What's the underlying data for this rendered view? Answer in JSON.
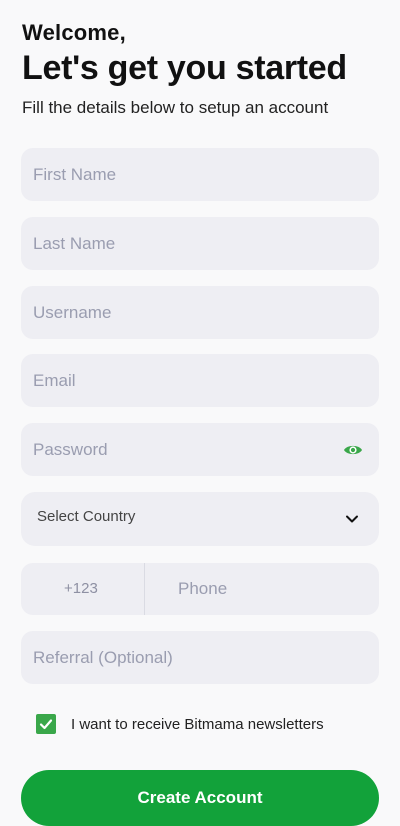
{
  "header": {
    "welcome": "Welcome,",
    "headline": "Let's get you started",
    "subline": "Fill the details below to setup an account"
  },
  "form": {
    "first_name": {
      "placeholder": "First Name",
      "value": ""
    },
    "last_name": {
      "placeholder": "Last Name",
      "value": ""
    },
    "username": {
      "placeholder": "Username",
      "value": ""
    },
    "email": {
      "placeholder": "Email",
      "value": ""
    },
    "password": {
      "placeholder": "Password",
      "value": "",
      "toggle_icon": "eye-icon"
    },
    "country": {
      "label": "Select Country",
      "icon": "chevron-down-icon"
    },
    "phone": {
      "dial_code": "+123",
      "placeholder": "Phone",
      "value": ""
    },
    "referral": {
      "placeholder": "Referral (Optional)",
      "value": ""
    },
    "newsletter": {
      "label": "I want to receive Bitmama newsletters",
      "checked": true
    }
  },
  "cta": {
    "label": "Create Account"
  },
  "colors": {
    "accent_green": "#12a23a",
    "checkbox_green": "#3aa74a",
    "field_bg": "#eeeef3",
    "placeholder": "#9a9db0"
  }
}
